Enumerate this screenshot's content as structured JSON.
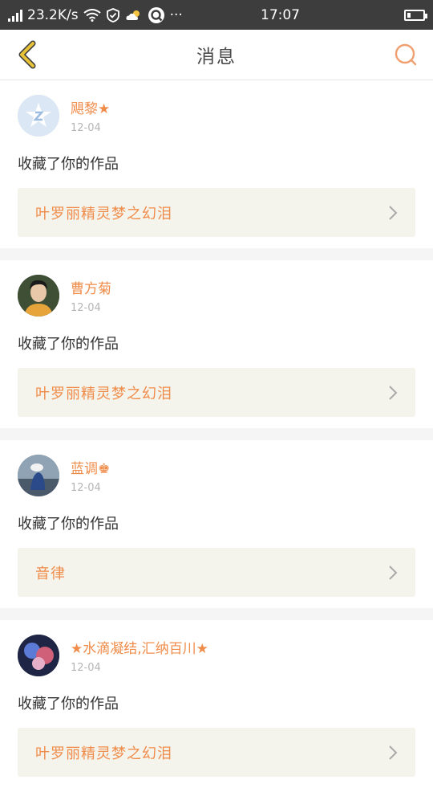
{
  "status_bar": {
    "speed": "23.2K/s",
    "time": "17:07",
    "more": "···"
  },
  "header": {
    "title": "消息",
    "back_icon": "chevron-left-icon",
    "search_icon": "search-icon"
  },
  "colors": {
    "accent": "#f08c4a",
    "back_arrow": "#e8c33a",
    "card_bg": "#f4f4ec"
  },
  "messages": [
    {
      "name": "飓黎★",
      "date": "12-04",
      "action": "收藏了你的作品",
      "work": "叶罗丽精灵梦之幻泪"
    },
    {
      "name": "曹方菊",
      "date": "12-04",
      "action": "收藏了你的作品",
      "work": "叶罗丽精灵梦之幻泪"
    },
    {
      "name": "蓝调♚",
      "date": "12-04",
      "action": "收藏了你的作品",
      "work": "音律"
    },
    {
      "name": "★水滴凝结,汇纳百川★",
      "date": "12-04",
      "action": "收藏了你的作品",
      "work": "叶罗丽精灵梦之幻泪"
    }
  ]
}
